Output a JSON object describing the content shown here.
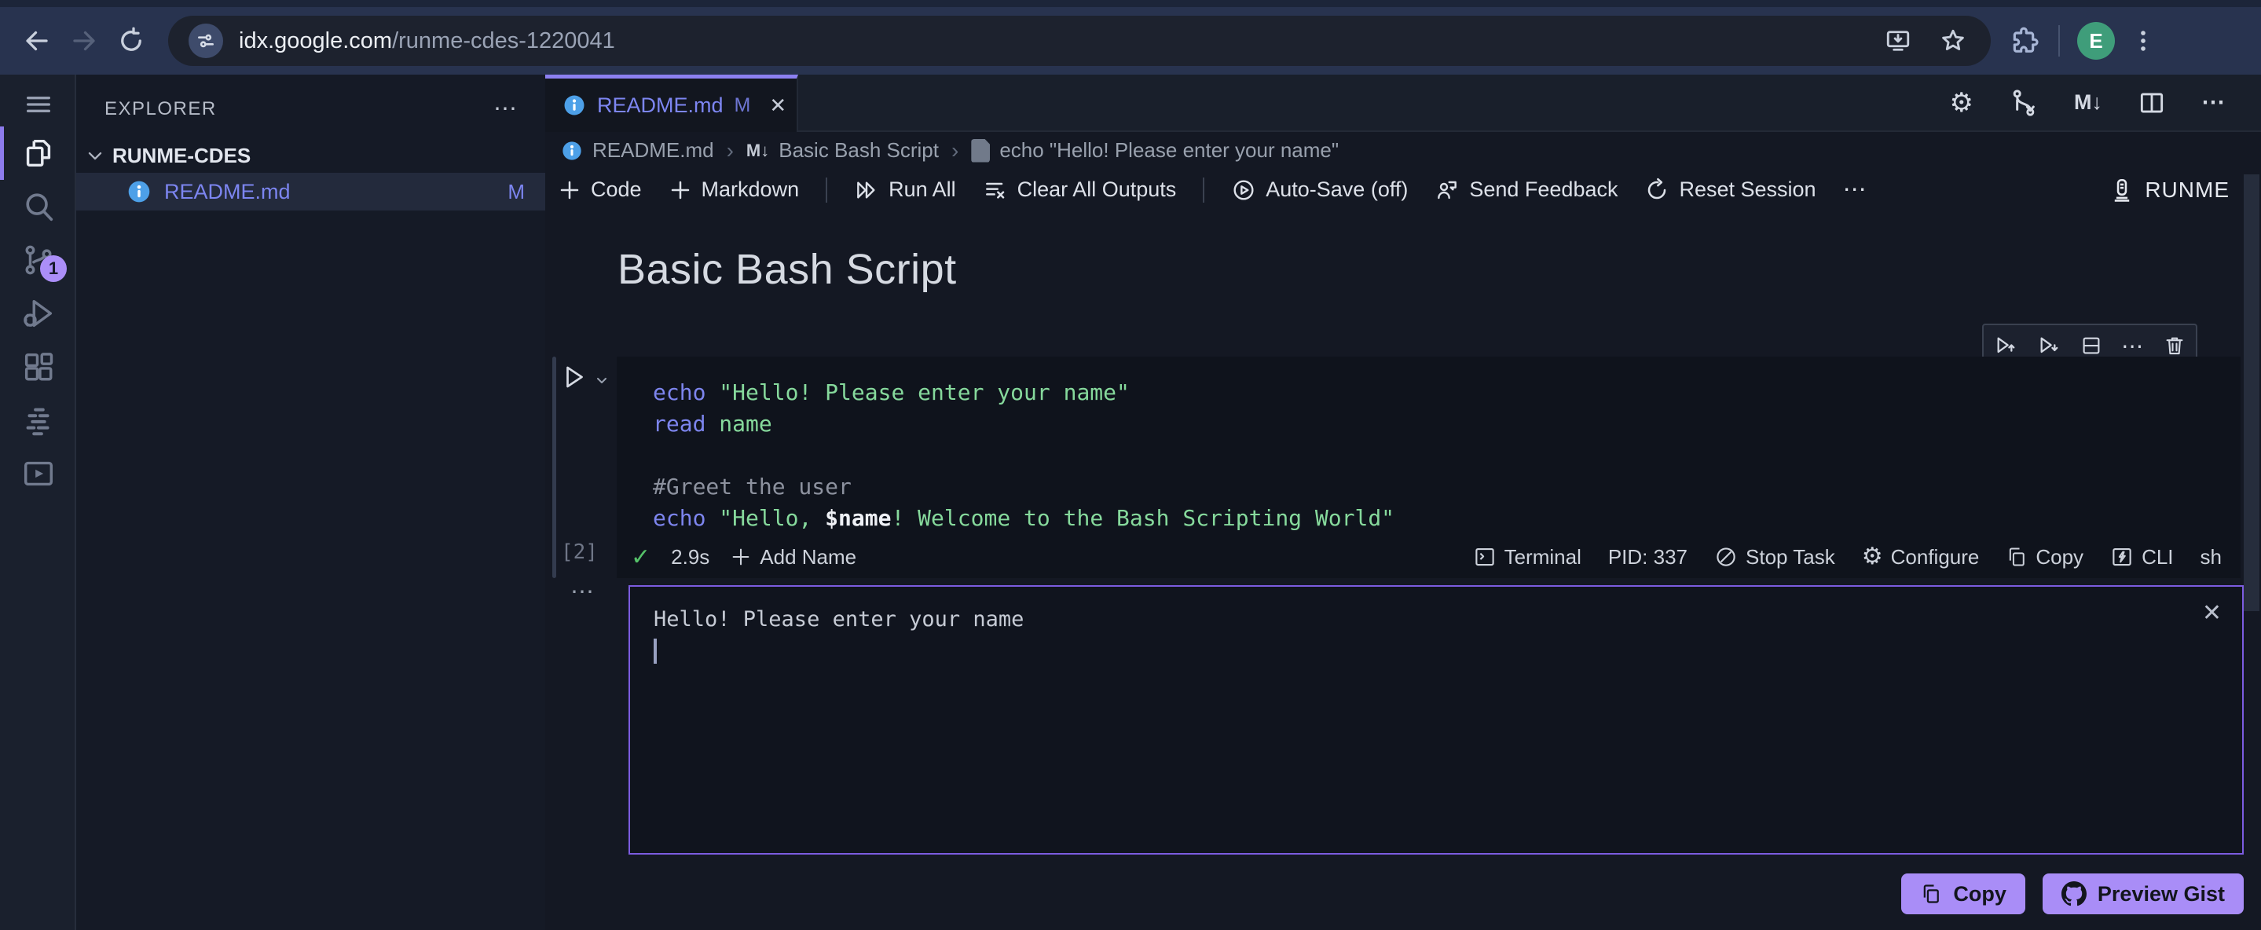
{
  "browser": {
    "url_host": "idx.google.com",
    "url_path": "/runme-cdes-1220041",
    "avatar_initial": "E"
  },
  "explorer": {
    "title": "EXPLORER",
    "workspace": "RUNME-CDES",
    "file": {
      "name": "README.md",
      "badge": "M"
    }
  },
  "tab": {
    "label": "README.md",
    "badge": "M"
  },
  "editor_actions": {
    "markdown_glyph": "M↓"
  },
  "breadcrumb": {
    "file": "README.md",
    "md_glyph": "M↓",
    "section": "Basic Bash Script",
    "cell": "echo \"Hello! Please enter your name\""
  },
  "toolbar": {
    "code": "Code",
    "markdown": "Markdown",
    "run_all": "Run All",
    "clear_outputs": "Clear All Outputs",
    "autosave": "Auto-Save (off)",
    "feedback": "Send Feedback",
    "reset": "Reset Session",
    "brand": "RUNME"
  },
  "notebook": {
    "heading": "Basic Bash Script",
    "cell": {
      "exec_count": "[2]",
      "code": [
        [
          {
            "t": "echo",
            "c": "kw"
          },
          {
            "t": " ",
            "c": "pl"
          },
          {
            "t": "\"Hello! Please enter your name\"",
            "c": "str"
          }
        ],
        [
          {
            "t": "read",
            "c": "kw"
          },
          {
            "t": " ",
            "c": "pl"
          },
          {
            "t": "name",
            "c": "str"
          }
        ],
        [],
        [
          {
            "t": "#Greet the user",
            "c": "cmt"
          }
        ],
        [
          {
            "t": "echo",
            "c": "kw"
          },
          {
            "t": " ",
            "c": "pl"
          },
          {
            "t": "\"Hello, ",
            "c": "str"
          },
          {
            "t": "$name",
            "c": "var"
          },
          {
            "t": "! Welcome to the Bash Scripting World\"",
            "c": "str"
          }
        ]
      ],
      "status": {
        "duration": "2.9s",
        "add_name": "Add Name"
      },
      "status_right": {
        "terminal": "Terminal",
        "pid": "PID: 337",
        "stop": "Stop Task",
        "configure": "Configure",
        "copy": "Copy",
        "cli": "CLI",
        "lang": "sh"
      }
    },
    "output": {
      "line1": "Hello! Please enter your name"
    },
    "footer": {
      "copy": "Copy",
      "preview_gist": "Preview Gist"
    }
  },
  "scm_badge": "1",
  "icons": {
    "more": "⋯",
    "close": "✕",
    "gear": "⚙",
    "crumb_sep": "›",
    "check": "✓"
  },
  "colors": {
    "accent_purple": "#7d86f2",
    "output_border": "#7c5ce0",
    "button_purple": "#a98df7",
    "string_green": "#86d99c",
    "keyword_indigo": "#7d85ee",
    "check_green": "#55c169",
    "avatar_green": "#3f9d7a",
    "info_blue": "#4da0e8"
  }
}
